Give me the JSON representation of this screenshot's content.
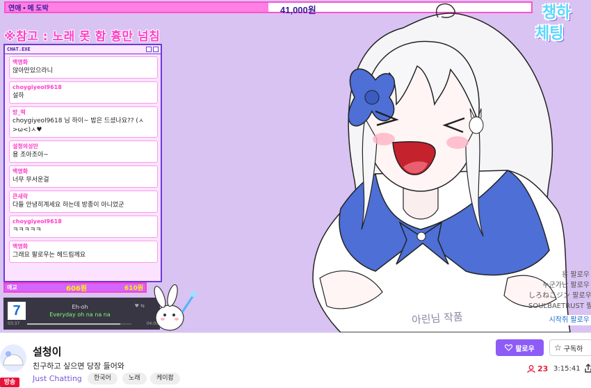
{
  "overlay": {
    "goal_label": "연애 • 메 도박",
    "goal_amount": "41,000원",
    "goal_progress": 0.5,
    "notice": "※참고 : 노래 못 함 흉만 넘침",
    "logo_line1": "챙하",
    "logo_line2": "체팅"
  },
  "chat": {
    "window_title": "CHAT.EXE",
    "messages": [
      {
        "nick": "백명화",
        "text": "않아만있으라니"
      },
      {
        "nick": "choygiyeol9618",
        "text": "설하"
      },
      {
        "nick": "방_떡",
        "text": "choygiyeol9618 님 하이~ 밥은 드셨나요?? (ㅅ>ω<)ㅅ♥"
      },
      {
        "nick": "설청의성만",
        "text": "용 조아조아~"
      },
      {
        "nick": "백명화",
        "text": "너무 무서운걸"
      },
      {
        "nick": "큰새락",
        "text": "다들 안녕히계세요 하는데 방종이 아니었군"
      },
      {
        "nick": "choygiyeol9618",
        "text": "ㅋㅋㅋㅋㅋ"
      },
      {
        "nick": "백명화",
        "text": "그래요 팔로우는 헤드림께요"
      }
    ],
    "footer_left": "애교",
    "footer_mid": "606원",
    "footer_right": "610원"
  },
  "player": {
    "album_char": "7",
    "song": "Eh-oh",
    "lyric": "Everyday oh na na na",
    "time_start": "03:37",
    "time_end": "04:08",
    "progress": 0.89
  },
  "followers": [
    "용 팔로우",
    "누군가난 팔로우",
    "しろねこジン 팔로우",
    "SOULBAETRUST 팔로우",
    "시작쥐 팔로우"
  ],
  "signature": "아린님 작품",
  "info": {
    "live_badge": "방송",
    "channel": "설청이",
    "title": "친구하고 싶으면 당장 들어와",
    "category": "Just Chatting",
    "tags": [
      "한국어",
      "노래",
      "케이팝"
    ],
    "follow_label": "팔로우",
    "subscribe_label": "구독하",
    "viewers": "23",
    "uptime": "3:15:41"
  },
  "colors": {
    "stream_bg": "#d9c3f2",
    "accent_pink": "#ff3ec9",
    "accent_purple": "#6a3bd8",
    "follow_button": "#8d5cf6",
    "live_red": "#e8123a"
  }
}
